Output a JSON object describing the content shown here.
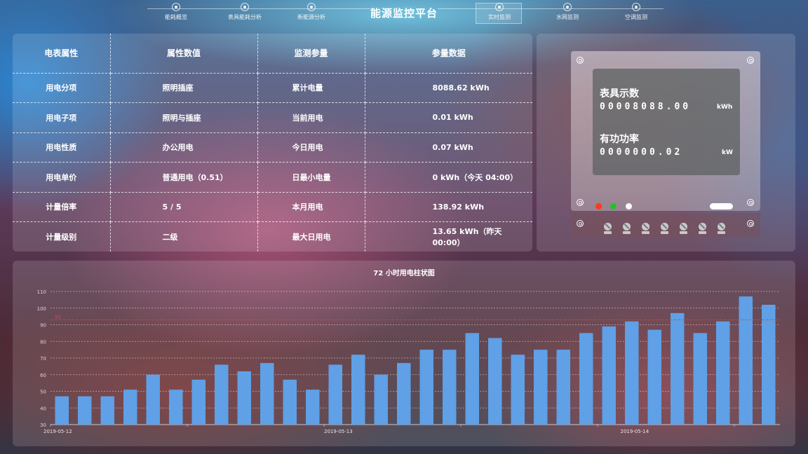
{
  "nav": {
    "title": "能源监控平台",
    "items": [
      {
        "label": "能耗概览",
        "active": false
      },
      {
        "label": "表具能耗分析",
        "active": false
      },
      {
        "label": "新能源分析",
        "active": false
      },
      {
        "label": "实时监测",
        "active": true
      },
      {
        "label": "水网监测",
        "active": false
      },
      {
        "label": "空调监测",
        "active": false
      }
    ]
  },
  "table": {
    "headers": [
      "电表属性",
      "属性数值",
      "监测参量",
      "参量数据"
    ],
    "rows": [
      [
        "用电分项",
        "照明插座",
        "累计电量",
        "8088.62 kWh"
      ],
      [
        "用电子项",
        "照明与插座",
        "当前用电",
        "0.01 kWh"
      ],
      [
        "用电性质",
        "办公用电",
        "今日用电",
        "0.07 kWh"
      ],
      [
        "用电单价",
        "普通用电（0.51）",
        "日最小电量",
        "0 kWh（今天 04:00）"
      ],
      [
        "计量倍率",
        "5 / 5",
        "本月用电",
        "138.92 kWh"
      ],
      [
        "计量级别",
        "二级",
        "最大日用电",
        "13.65 kWh（昨天 00:00）"
      ]
    ]
  },
  "meter": {
    "reading_label": "表具示数",
    "reading_value": "00008088.00",
    "reading_unit": "kWh",
    "power_label": "有功功率",
    "power_value": "0000000.02",
    "power_unit": "kW",
    "led_colors": [
      "#ff3a1a",
      "#22c22a",
      "#ffffff"
    ]
  },
  "chart_data": {
    "type": "bar",
    "title": "72 小时用电柱状图",
    "ylim": [
      30,
      110
    ],
    "yticks": [
      30,
      40,
      50,
      60,
      70,
      80,
      90,
      100,
      110
    ],
    "x_labels": [
      {
        "label": "2019-05-12",
        "index": 0
      },
      {
        "label": "2019-05-13",
        "index": 12
      },
      {
        "label": "2019-05-14",
        "index": 25
      }
    ],
    "values": [
      47,
      47,
      47,
      51,
      60,
      51,
      57,
      66,
      62,
      67,
      57,
      51,
      66,
      72,
      60,
      67,
      75,
      75,
      85,
      82,
      72,
      75,
      75,
      85,
      89,
      92,
      87,
      97,
      85,
      92,
      107,
      102
    ],
    "markline": {
      "value": 93,
      "label": "93"
    },
    "bar_color": "#5fa0e6",
    "markline_color": "#c0504d"
  }
}
